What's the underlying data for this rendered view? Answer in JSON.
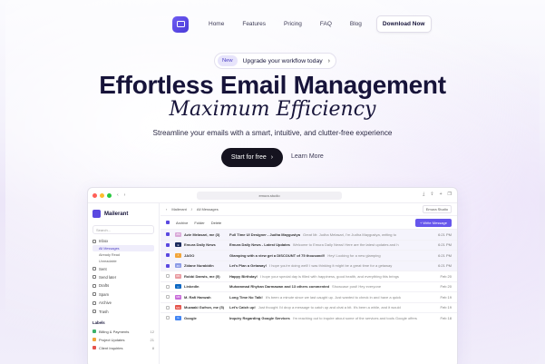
{
  "nav": {
    "links": [
      "Home",
      "Features",
      "Pricing",
      "FAQ",
      "Blog"
    ],
    "cta": "Download Now"
  },
  "hero": {
    "badge": "New",
    "announcement": "Upgrade your workflow today",
    "title": "Effortless Email Management",
    "subtitle": "Maximum Efficiency",
    "tagline": "Streamline your emails with a smart, intuitive, and clutter-free experience",
    "primary": "Start for free",
    "secondary": "Learn More"
  },
  "app": {
    "url": "emura.studio",
    "brand": "Mailerant",
    "search": "Search...",
    "menu": [
      {
        "label": "Inbox",
        "sub": false
      },
      {
        "label": "All Messages",
        "sub": true,
        "active": true
      },
      {
        "label": "Already Read",
        "sub": true
      },
      {
        "label": "Unreadable",
        "sub": true
      },
      {
        "label": "Sent",
        "sub": false
      },
      {
        "label": "Send later",
        "sub": false
      },
      {
        "label": "Drafts",
        "sub": false
      },
      {
        "label": "Spam",
        "sub": false
      },
      {
        "label": "Archive",
        "sub": false
      },
      {
        "label": "Trash",
        "sub": false
      }
    ],
    "labels_title": "Labels",
    "labels": [
      {
        "name": "Billing & Payments",
        "count": "12",
        "color": "#3bb26a"
      },
      {
        "name": "Project Updates",
        "count": "21",
        "color": "#f2a53a"
      },
      {
        "name": "Client Inquiries",
        "count": "8",
        "color": "#e5534b"
      }
    ],
    "crumb": [
      "Mailerant",
      "All Messages"
    ],
    "workspace": "Emura Studio",
    "actions": [
      "Archive",
      "Folder",
      "Delete"
    ],
    "write": "+ Write Message",
    "emails": [
      {
        "from": "Azie Melasari, me (3)",
        "subject": "Full Time UI Designer - Judha Maygustya",
        "preview": "Great Mr. Judha Melasari, I'm Judha Maygustya, writing to",
        "time": "6:21 PM",
        "checked": true,
        "av": "AM",
        "color": "#d9a8d8"
      },
      {
        "from": "Emura Daily News",
        "subject": "Emura Daily News - Latest Updates",
        "preview": "Welcome to Emura Daily News! Here are the latest updates and h",
        "time": "6:21 PM",
        "checked": true,
        "av": "E",
        "color": "#1b2a5c"
      },
      {
        "from": "JAGO",
        "subject": "Glamping with a view get a DISCOUNT of 75 thousand!!",
        "preview": "Hey! Looking for a new glamping",
        "time": "6:21 PM",
        "checked": true,
        "av": "J",
        "color": "#f2a53a"
      },
      {
        "from": "Zidane Nurabidin",
        "subject": "Let's Plan a Getaway!",
        "preview": "I hope you're doing well! I was thinking it might be a great time for a getaway",
        "time": "6:21 PM",
        "checked": true,
        "av": "ZN",
        "color": "#8b9be6"
      },
      {
        "from": "Robbi Darwis, me (5)",
        "subject": "Happy Birthday!",
        "preview": "I hope your special day is filled with happiness, good health, and everything this brings",
        "time": "Feb 20",
        "checked": false,
        "av": "RD",
        "color": "#e99aa0"
      },
      {
        "from": "LinkedIn",
        "subject": "Muhammad Rhyhan Darmawan and 13 others commented",
        "preview": "Showcase post! Hey everyone",
        "time": "Feb 20",
        "checked": false,
        "av": "in",
        "color": "#0a66c2"
      },
      {
        "from": "M. Rafi Hamzah",
        "subject": "Long Time No Talk!",
        "preview": "It's been a minute since we last caught up. Just wanted to check in and have a quick",
        "time": "Feb 19",
        "checked": false,
        "av": "MR",
        "color": "#c86bd9"
      },
      {
        "from": "Muzaaki Gufron, me (5)",
        "subject": "Let's Catch up!",
        "preview": "Just thought I'd drop a message to catch up and chat a bit. It's been a while, and it would",
        "time": "Feb 19",
        "checked": false,
        "av": "MG",
        "color": "#e5534b"
      },
      {
        "from": "Google",
        "subject": "Inquiry Regarding Google Services",
        "preview": "I'm reaching out to inquire about some of the services and tools Google offers",
        "time": "Feb 18",
        "checked": false,
        "av": "G",
        "color": "#4285f4"
      }
    ]
  }
}
